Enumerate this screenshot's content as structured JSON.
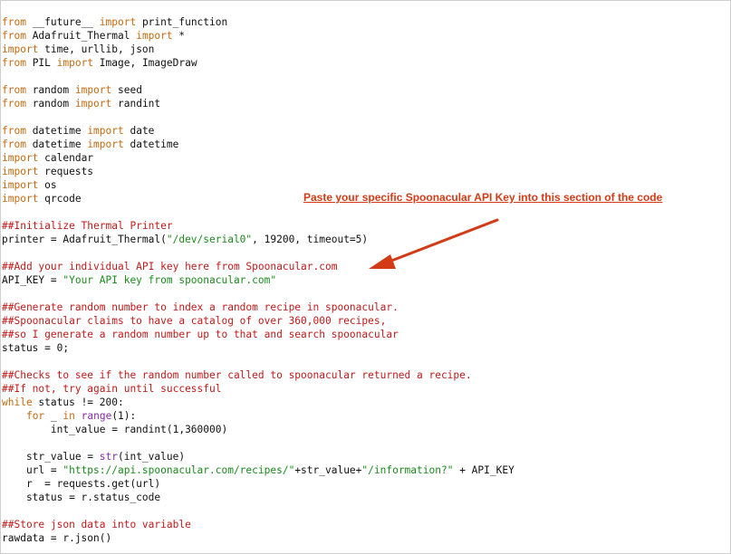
{
  "annotation": "Paste your specific Spoonacular API Key into this section of the code",
  "colors": {
    "keyword": "#c46a12",
    "comment": "#c01a1a",
    "string": "#1c8a1c",
    "builtin": "#8a2aa8",
    "annotation": "#d23b16"
  },
  "code_lines": [
    [
      [
        "kw",
        "from"
      ],
      [
        "t",
        " __future__ "
      ],
      [
        "kw",
        "import"
      ],
      [
        "t",
        " print_function"
      ]
    ],
    [
      [
        "kw",
        "from"
      ],
      [
        "t",
        " Adafruit_Thermal "
      ],
      [
        "kw",
        "import"
      ],
      [
        "t",
        " *"
      ]
    ],
    [
      [
        "kw",
        "import"
      ],
      [
        "t",
        " time, urllib, json"
      ]
    ],
    [
      [
        "kw",
        "from"
      ],
      [
        "t",
        " PIL "
      ],
      [
        "kw",
        "import"
      ],
      [
        "t",
        " Image, ImageDraw"
      ]
    ],
    [],
    [
      [
        "kw",
        "from"
      ],
      [
        "t",
        " random "
      ],
      [
        "kw",
        "import"
      ],
      [
        "t",
        " seed"
      ]
    ],
    [
      [
        "kw",
        "from"
      ],
      [
        "t",
        " random "
      ],
      [
        "kw",
        "import"
      ],
      [
        "t",
        " randint"
      ]
    ],
    [],
    [
      [
        "kw",
        "from"
      ],
      [
        "t",
        " datetime "
      ],
      [
        "kw",
        "import"
      ],
      [
        "t",
        " date"
      ]
    ],
    [
      [
        "kw",
        "from"
      ],
      [
        "t",
        " datetime "
      ],
      [
        "kw",
        "import"
      ],
      [
        "t",
        " datetime"
      ]
    ],
    [
      [
        "kw",
        "import"
      ],
      [
        "t",
        " calendar"
      ]
    ],
    [
      [
        "kw",
        "import"
      ],
      [
        "t",
        " requests"
      ]
    ],
    [
      [
        "kw",
        "import"
      ],
      [
        "t",
        " os"
      ]
    ],
    [
      [
        "kw",
        "import"
      ],
      [
        "t",
        " qrcode"
      ]
    ],
    [],
    [
      [
        "cm",
        "##Initialize Thermal Printer"
      ]
    ],
    [
      [
        "t",
        "printer = Adafruit_Thermal("
      ],
      [
        "st",
        "\"/dev/serial0\""
      ],
      [
        "t",
        ", 19200, timeout=5)"
      ]
    ],
    [],
    [
      [
        "cm",
        "##Add your individual API key here from Spoonacular.com"
      ]
    ],
    [
      [
        "t",
        "API_KEY = "
      ],
      [
        "st",
        "\"Your API key from spoonacular.com\""
      ]
    ],
    [],
    [
      [
        "cm",
        "##Generate random number to index a random recipe in spoonacular."
      ]
    ],
    [
      [
        "cm",
        "##Spoonacular claims to have a catalog of over 360,000 recipes,"
      ]
    ],
    [
      [
        "cm",
        "##so I generate a random number up to that and search spoonacular"
      ]
    ],
    [
      [
        "t",
        "status = 0;"
      ]
    ],
    [],
    [
      [
        "cm",
        "##Checks to see if the random number called to spoonacular returned a recipe."
      ]
    ],
    [
      [
        "cm",
        "##If not, try again until successful"
      ]
    ],
    [
      [
        "kw",
        "while"
      ],
      [
        "t",
        " status != 200:"
      ]
    ],
    [
      [
        "t",
        "    "
      ],
      [
        "kw",
        "for"
      ],
      [
        "t",
        " _ "
      ],
      [
        "kw",
        "in"
      ],
      [
        "t",
        " "
      ],
      [
        "bi",
        "range"
      ],
      [
        "t",
        "(1):"
      ]
    ],
    [
      [
        "t",
        "        int_value = randint(1,360000)"
      ]
    ],
    [],
    [
      [
        "t",
        "    str_value = "
      ],
      [
        "bi",
        "str"
      ],
      [
        "t",
        "(int_value)"
      ]
    ],
    [
      [
        "t",
        "    url = "
      ],
      [
        "st",
        "\"https://api.spoonacular.com/recipes/\""
      ],
      [
        "t",
        "+str_value+"
      ],
      [
        "st",
        "\"/information?\""
      ],
      [
        "t",
        " + API_KEY"
      ]
    ],
    [
      [
        "t",
        "    r  = requests.get(url)"
      ]
    ],
    [
      [
        "t",
        "    status = r.status_code"
      ]
    ],
    [],
    [
      [
        "cm",
        "##Store json data into variable"
      ]
    ],
    [
      [
        "t",
        "rawdata = r.json()"
      ]
    ]
  ]
}
